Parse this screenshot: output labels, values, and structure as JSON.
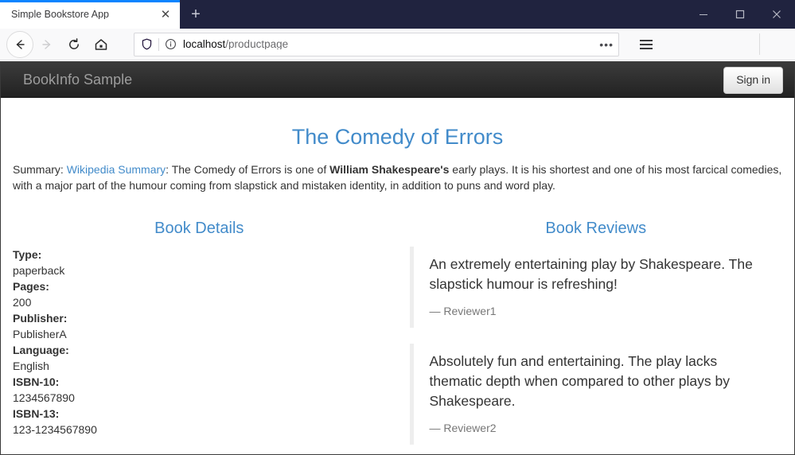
{
  "browser": {
    "tab": {
      "title": "Simple Bookstore App",
      "close_label": "✕"
    },
    "new_tab_label": "+",
    "window_controls": {
      "minimize": "minimize-button",
      "maximize": "maximize-button",
      "close": "close-button"
    },
    "nav": {
      "back": "back-button",
      "forward": "forward-button",
      "reload": "reload-button",
      "home": "home-button"
    },
    "urlbar": {
      "host": "localhost",
      "path": "/productpage",
      "page_actions_label": "•••",
      "shield_icon": "tracking-protection-shield-icon",
      "info_icon": "site-information-icon"
    },
    "menu_label": "application-menu-button"
  },
  "site": {
    "brand": "BookInfo Sample",
    "signin_label": "Sign in"
  },
  "page": {
    "title": "The Comedy of Errors",
    "summary": {
      "prefix": "Summary: ",
      "link_text": "Wikipedia Summary",
      "after_link": ": The Comedy of Errors is one of ",
      "bold_text": "William Shakespeare's",
      "rest": " early plays. It is his shortest and one of his most farcical comedies, with a major part of the humour coming from slapstick and mistaken identity, in addition to puns and word play."
    },
    "details": {
      "heading": "Book Details",
      "items": [
        {
          "key": "Type:",
          "value": "paperback"
        },
        {
          "key": "Pages:",
          "value": "200"
        },
        {
          "key": "Publisher:",
          "value": "PublisherA"
        },
        {
          "key": "Language:",
          "value": "English"
        },
        {
          "key": "ISBN-10:",
          "value": "1234567890"
        },
        {
          "key": "ISBN-13:",
          "value": "123-1234567890"
        }
      ]
    },
    "reviews": {
      "heading": "Book Reviews",
      "items": [
        {
          "text": "An extremely entertaining play by Shakespeare. The slapstick humour is refreshing!",
          "author": "— Reviewer1"
        },
        {
          "text": "Absolutely fun and entertaining. The play lacks thematic depth when compared to other plays by Shakespeare.",
          "author": "— Reviewer2"
        }
      ]
    }
  },
  "colors": {
    "titlebar": "#20233f",
    "tab_accent": "#0a84ff",
    "navbar_top": "#3c3c3c",
    "navbar_bottom": "#222222",
    "brand_text": "#9d9d9d",
    "link_blue": "#428bca",
    "body_text": "#333333",
    "muted_text": "#777777",
    "blockquote_border": "#eeeeee"
  }
}
